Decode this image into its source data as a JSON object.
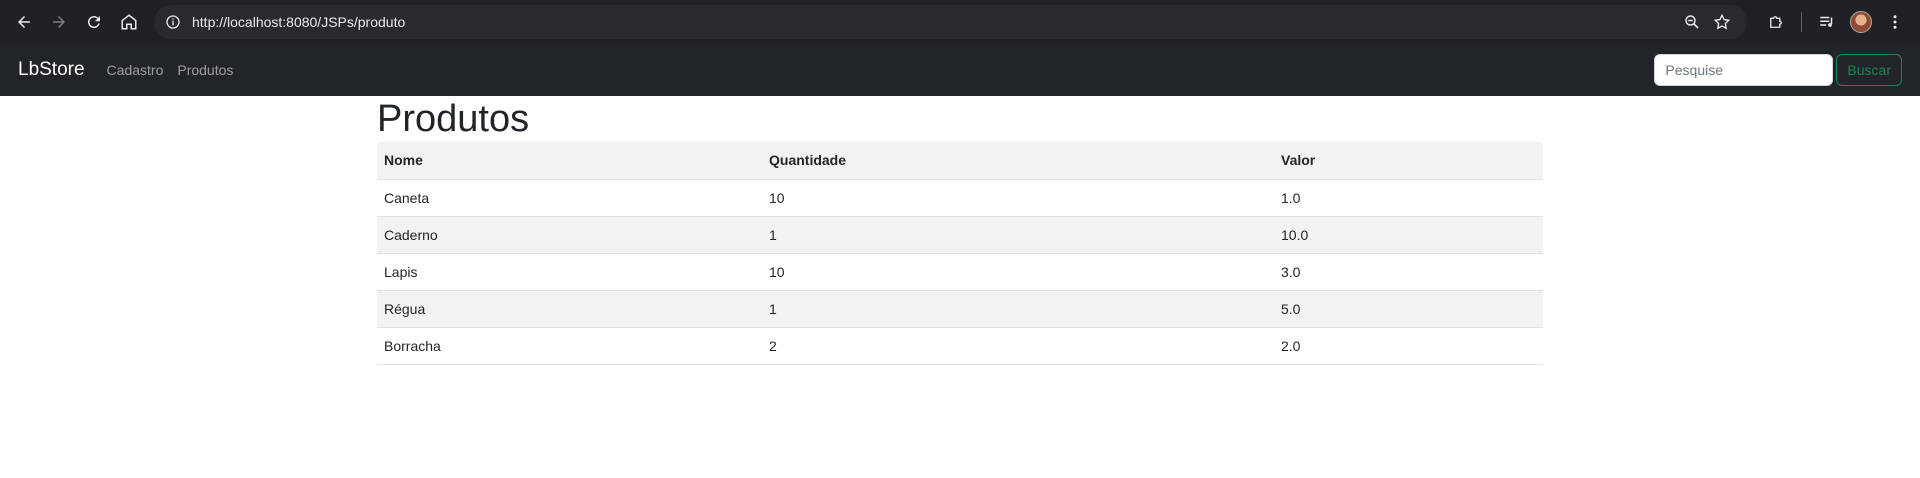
{
  "browser": {
    "url": "http://localhost:8080/JSPs/produto"
  },
  "navbar": {
    "brand": "LbStore",
    "links": [
      "Cadastro",
      "Produtos"
    ],
    "search_placeholder": "Pesquise",
    "search_button": "Buscar"
  },
  "main": {
    "title": "Produtos",
    "table": {
      "headers": [
        "Nome",
        "Quantidade",
        "Valor"
      ],
      "rows": [
        [
          "Caneta",
          "10",
          "1.0"
        ],
        [
          "Caderno",
          "1",
          "10.0"
        ],
        [
          "Lapis",
          "10",
          "3.0"
        ],
        [
          "Régua",
          "1",
          "5.0"
        ],
        [
          "Borracha",
          "2",
          "2.0"
        ]
      ]
    }
  }
}
